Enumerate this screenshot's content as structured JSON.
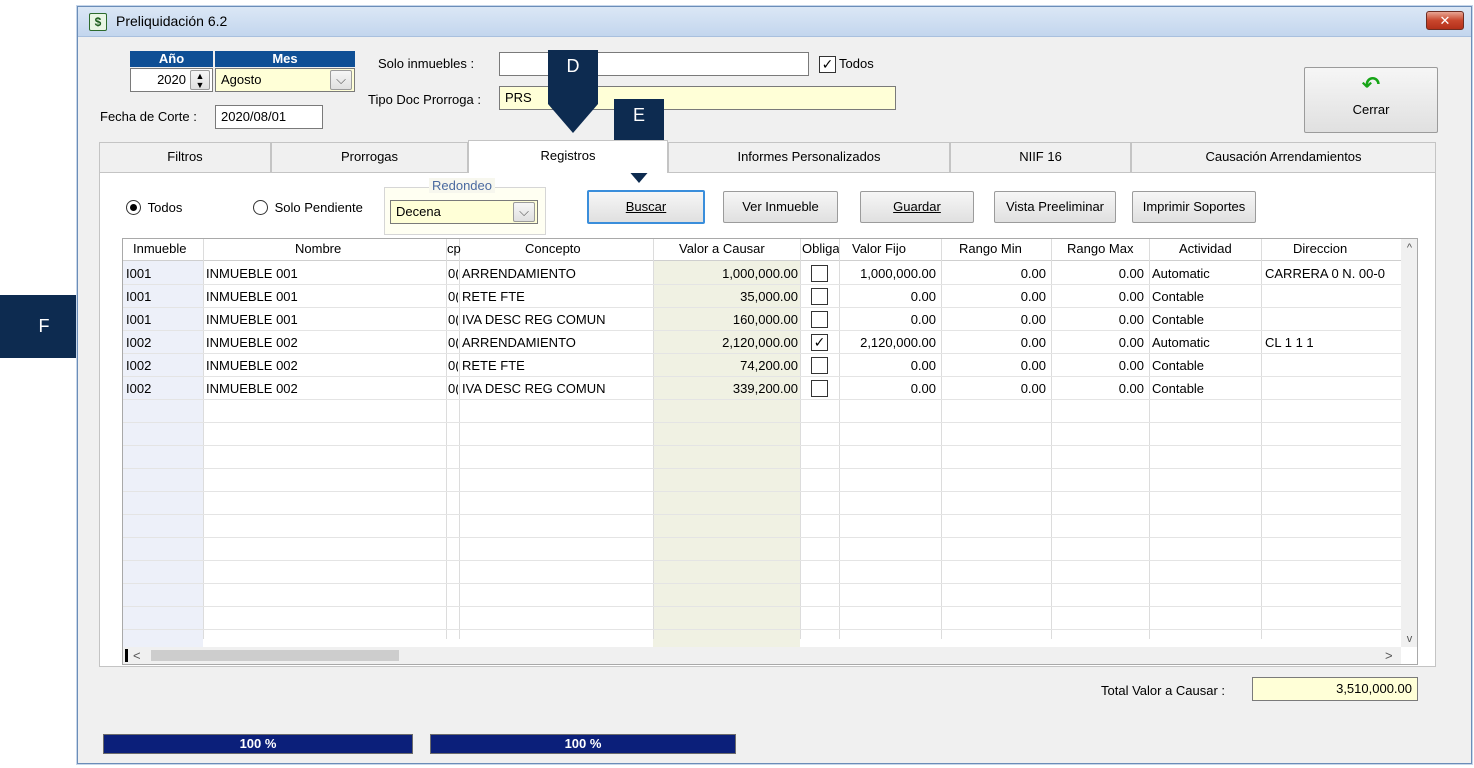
{
  "window": {
    "title": "Preliquidación 6.2",
    "close_glyph": "✕"
  },
  "period": {
    "year_header": "Año",
    "month_header": "Mes",
    "year": "2020",
    "month": "Agosto",
    "cut_date_label": "Fecha de Corte :",
    "cut_date": "2020/08/01"
  },
  "filters": {
    "solo_inmuebles_label": "Solo inmuebles :",
    "solo_inmuebles_value": "",
    "todos_check_label": "Todos",
    "tipo_doc_label": "Tipo Doc Prorroga :",
    "tipo_doc_value": "PRS"
  },
  "close_button": {
    "label": "Cerrar",
    "icon": "undo-arrow-icon"
  },
  "tabs": [
    {
      "label": "Filtros"
    },
    {
      "label": "Prorrogas"
    },
    {
      "label": "Registros"
    },
    {
      "label": "Informes Personalizados"
    },
    {
      "label": "NIIF 16"
    },
    {
      "label": "Causación Arrendamientos"
    }
  ],
  "registros": {
    "radio_todos": "Todos",
    "radio_pendiente": "Solo Pendiente",
    "redondeo_legend": "Redondeo",
    "redondeo_value": "Decena",
    "buttons": {
      "buscar": "Buscar",
      "ver_inmueble": "Ver Inmueble",
      "guardar": "Guardar",
      "vista": "Vista Preeliminar",
      "imprimir": "Imprimir Soportes"
    }
  },
  "grid": {
    "columns": [
      "Inmueble",
      "Nombre",
      "cp",
      "Concepto",
      "Valor a Causar",
      "Obliga",
      "Valor Fijo",
      "Rango Min",
      "Rango Max",
      "Actividad",
      "Direccion"
    ],
    "rows": [
      {
        "inmueble": "I001",
        "nombre": "INMUEBLE 001",
        "cp": "0(",
        "concepto": "ARRENDAMIENTO",
        "valor": "1,000,000.00",
        "obliga": "",
        "fijo": "1,000,000.00",
        "min": "0.00",
        "max": "0.00",
        "actividad": "Automatic",
        "direccion": "CARRERA 0 N. 00-0"
      },
      {
        "inmueble": "I001",
        "nombre": "INMUEBLE 001",
        "cp": "0(",
        "concepto": "RETE FTE",
        "valor": "35,000.00",
        "obliga": "",
        "fijo": "0.00",
        "min": "0.00",
        "max": "0.00",
        "actividad": "Contable",
        "direccion": ""
      },
      {
        "inmueble": "I001",
        "nombre": "INMUEBLE 001",
        "cp": "0(",
        "concepto": "IVA DESC REG COMUN",
        "valor": "160,000.00",
        "obliga": "",
        "fijo": "0.00",
        "min": "0.00",
        "max": "0.00",
        "actividad": "Contable",
        "direccion": ""
      },
      {
        "inmueble": "I002",
        "nombre": "INMUEBLE 002",
        "cp": "0(",
        "concepto": "ARRENDAMIENTO",
        "valor": "2,120,000.00",
        "obliga": "✓",
        "fijo": "2,120,000.00",
        "min": "0.00",
        "max": "0.00",
        "actividad": "Automatic",
        "direccion": "CL 1 1 1"
      },
      {
        "inmueble": "I002",
        "nombre": "INMUEBLE 002",
        "cp": "0(",
        "concepto": "RETE FTE",
        "valor": "74,200.00",
        "obliga": "",
        "fijo": "0.00",
        "min": "0.00",
        "max": "0.00",
        "actividad": "Contable",
        "direccion": ""
      },
      {
        "inmueble": "I002",
        "nombre": "INMUEBLE 002",
        "cp": "0(",
        "concepto": "IVA DESC REG COMUN",
        "valor": "339,200.00",
        "obliga": "",
        "fijo": "0.00",
        "min": "0.00",
        "max": "0.00",
        "actividad": "Contable",
        "direccion": ""
      }
    ]
  },
  "total": {
    "label": "Total Valor a Causar :",
    "value": "3,510,000.00"
  },
  "progress": [
    {
      "label": "100 %",
      "value": 100
    },
    {
      "label": "100 %",
      "value": 100
    }
  ],
  "annotations": {
    "d": "D",
    "e": "E",
    "f": "F"
  },
  "glyphs": {
    "scroll_up": "^",
    "scroll_down": "v",
    "scroll_left": "<",
    "scroll_right": ">",
    "dropdown": "⌵"
  }
}
